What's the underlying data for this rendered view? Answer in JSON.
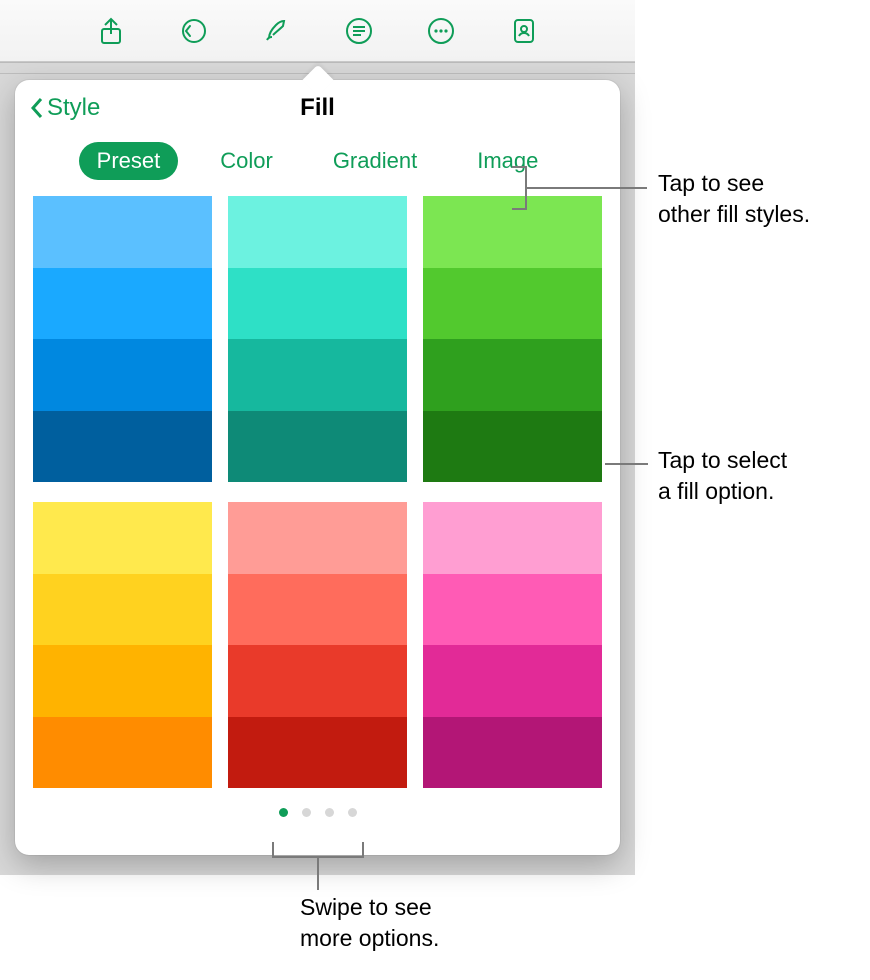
{
  "accent": "#0f9d58",
  "toolbar_icons": [
    "share-icon",
    "undo-icon",
    "format-icon",
    "justify-icon",
    "more-icon",
    "presenter-icon"
  ],
  "popover": {
    "back_label": "Style",
    "title": "Fill",
    "segments": [
      {
        "label": "Preset",
        "active": true
      },
      {
        "label": "Color",
        "active": false
      },
      {
        "label": "Gradient",
        "active": false
      },
      {
        "label": "Image",
        "active": false
      }
    ],
    "swatch_blocks": [
      {
        "name": "blue",
        "colors": [
          "#5bc0ff",
          "#1aa9ff",
          "#0088e0",
          "#005f9e"
        ]
      },
      {
        "name": "teal",
        "colors": [
          "#6cf2e0",
          "#2ee0c6",
          "#16b89e",
          "#0e8a77"
        ]
      },
      {
        "name": "green",
        "colors": [
          "#7ce652",
          "#52c92e",
          "#2fa01e",
          "#1e7a12"
        ]
      },
      {
        "name": "yellow",
        "colors": [
          "#ffe94d",
          "#ffd21f",
          "#ffb300",
          "#ff8c00"
        ]
      },
      {
        "name": "red",
        "colors": [
          "#ff9c96",
          "#ff6c5c",
          "#e93a2a",
          "#c21b0f"
        ]
      },
      {
        "name": "pink",
        "colors": [
          "#ff9ed2",
          "#ff5bb5",
          "#e22a97",
          "#b31676"
        ]
      }
    ],
    "page_dots": {
      "count": 4,
      "active_index": 0
    }
  },
  "callouts": {
    "fill_styles": "Tap to see\nother fill styles.",
    "fill_option": "Tap to select\na fill option.",
    "swipe": "Swipe to see\nmore options."
  }
}
